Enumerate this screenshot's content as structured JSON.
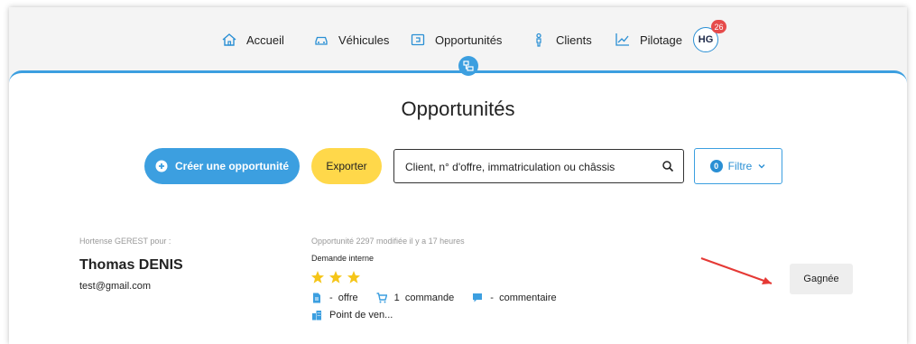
{
  "nav": {
    "items": [
      {
        "label": "Accueil",
        "icon": "home-icon"
      },
      {
        "label": "Véhicules",
        "icon": "car-icon"
      },
      {
        "label": "Opportunités",
        "icon": "tag-icon"
      },
      {
        "label": "Clients",
        "icon": "person-icon"
      },
      {
        "label": "Pilotage",
        "icon": "chart-line-icon"
      }
    ],
    "avatar_initials": "HG",
    "notification_count": "26"
  },
  "page": {
    "title": "Opportunités"
  },
  "toolbar": {
    "create_label": "Créer une opportunité",
    "export_label": "Exporter",
    "search_placeholder": "Client, n° d'offre, immatriculation ou châssis",
    "filter_count": "0",
    "filter_label": "Filtre"
  },
  "opportunity": {
    "owner_label": "Hortense GEREST pour :",
    "client_name": "Thomas DENIS",
    "client_email": "test@gmail.com",
    "meta": "Opportunité 2297 modifiée il y a 17 heures",
    "source": "Demande interne",
    "rating": 3,
    "offers_count": "-",
    "offers_label": "offre",
    "orders_count": "1",
    "orders_label": "commande",
    "comments_count": "-",
    "comments_label": "commentaire",
    "point_of_sale": "Point de ven...",
    "status": "Gagnée"
  },
  "colors": {
    "accent": "#3c9fe0",
    "export": "#ffd84a",
    "star": "#f5c518",
    "badge": "#e64b4b",
    "arrow": "#e53935"
  }
}
